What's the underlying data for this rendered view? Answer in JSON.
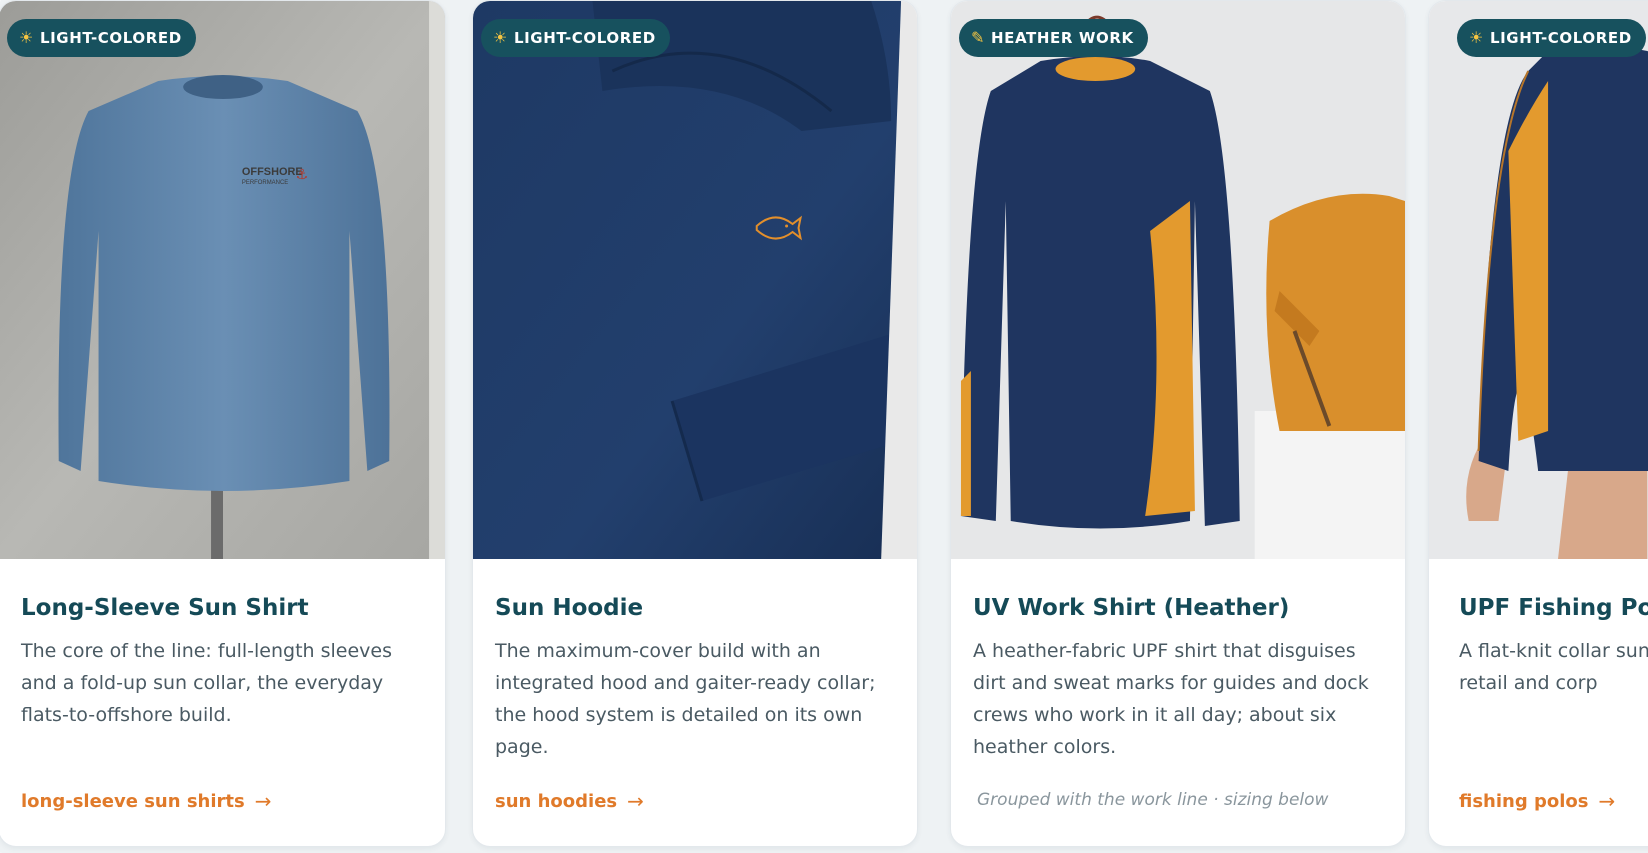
{
  "cards": [
    {
      "badge": "LIGHT-COLORED",
      "badge_icon": "sun-icon",
      "title": "Long-Sleeve Sun Shirt",
      "description": "The core of the line: full-length sleeves and a fold-up sun collar, the everyday flats-to-offshore build.",
      "link": "long-sleeve sun shirts",
      "garment_color": "#5f86ad",
      "chest_logo": "OFFSHORE",
      "chest_logo_sub": "PERFORMANCE"
    },
    {
      "badge": "LIGHT-COLORED",
      "badge_icon": "sun-icon",
      "title": "Sun Hoodie",
      "description": "The maximum-cover build with an integrated hood and gaiter-ready collar; the hood system is detailed on its own page.",
      "link": "sun hoodies",
      "garment_color": "#1f3a66"
    },
    {
      "badge": "HEATHER WORK",
      "badge_icon": "leaf-icon",
      "title": "UV Work Shirt (Heather)",
      "description": "A heather-fabric UPF shirt that disguises dirt and sweat marks for guides and dock crews who work in it all day; about six heather colors.",
      "note": "Grouped with the work line · sizing below",
      "garment_color": "#1f3560",
      "accent_color": "#e39a2e"
    },
    {
      "badge": "LIGHT-COLORED",
      "badge_icon": "sun-icon",
      "title": "UPF Fishing Polo",
      "description": "A flat-knit collar sun resort retail and corp",
      "link": "fishing polos",
      "garment_color": "#1f3560",
      "accent_color": "#e39a2e"
    }
  ],
  "colors": {
    "badge_bg": "#17515e",
    "title": "#154a57",
    "link": "#e07a2a",
    "body_text": "#4a5a63"
  }
}
